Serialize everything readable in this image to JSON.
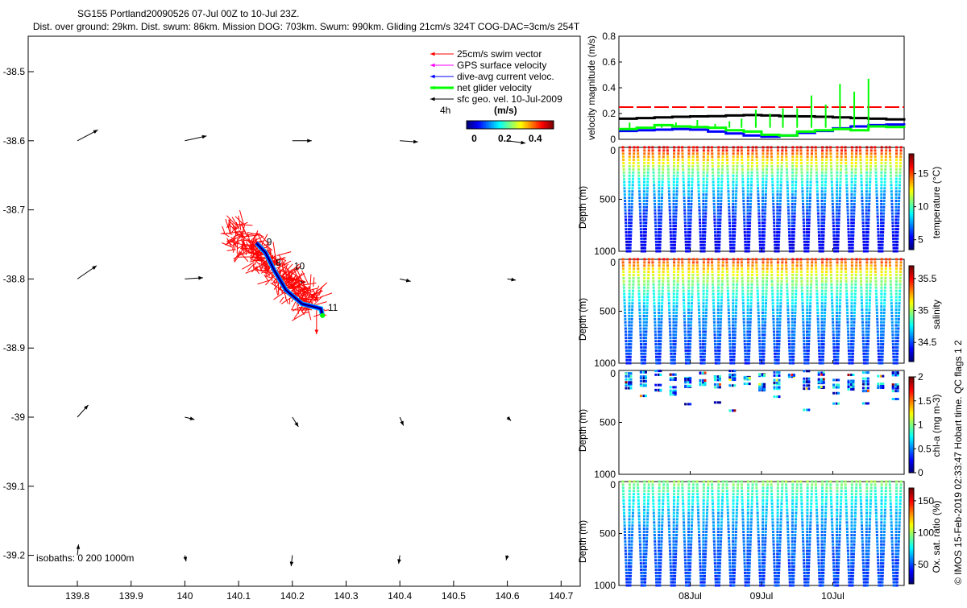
{
  "title": {
    "line1": "SG155 Portland20090526 07-Jul 00Z to 10-Jul 23Z.",
    "line2": "Dist. over ground: 29km. Dist. swum: 86km. Mission DOG: 703km. Swum: 990km. Gliding 21cm/s 324T COG-DAC=3cm/s 254T"
  },
  "footer": "© IMOS 15-Feb-2019 02:33:47 Hobart time. QC flags 1  2",
  "chart_data": [
    {
      "type": "map",
      "xlim": [
        139.72,
        140.73
      ],
      "ylim": [
        -39.28,
        -38.45
      ],
      "xticks": [
        "139.8",
        "139.9",
        "140",
        "140.1",
        "140.2",
        "140.3",
        "140.4",
        "140.5",
        "140.6",
        "140.7"
      ],
      "yticks": [
        "-38.5",
        "-38.6",
        "-38.7",
        "-38.8",
        "-38.9",
        "-39",
        "-39.1",
        "-39.2"
      ],
      "isobath_label": "isobaths: 0   200  1000m",
      "legend": {
        "placement": "top-right",
        "items": [
          {
            "label": "25cm/s swim vector",
            "color": "#ff0000"
          },
          {
            "label": "GPS surface velocity",
            "color": "#ff00ff"
          },
          {
            "label": "dive-avg current veloc.",
            "color": "#0000ff"
          },
          {
            "label": "net glider velocity",
            "color": "#00ff00"
          },
          {
            "label": "sfc geo. vel. 10-Jul-2009",
            "color": "#000000"
          }
        ],
        "time_label": "4h",
        "colorbar_units": "(m/s)",
        "colorbar_ticks": [
          "0",
          "0.2",
          "0.4"
        ],
        "colorbar_range": [
          -0.05,
          0.52
        ]
      },
      "glider_track": [
        [
          140.133,
          -38.748
        ],
        [
          140.15,
          -38.762
        ],
        [
          140.166,
          -38.787
        ],
        [
          140.188,
          -38.816
        ],
        [
          140.218,
          -38.836
        ],
        [
          140.253,
          -38.843
        ],
        [
          140.256,
          -38.853
        ]
      ],
      "track_labels": [
        {
          "text": "8",
          "lon": 140.169,
          "lat": -38.781
        },
        {
          "text": "9",
          "lon": 140.152,
          "lat": -38.751
        },
        {
          "text": "10",
          "lon": 140.203,
          "lat": -38.786
        },
        {
          "text": "11",
          "lon": 140.266,
          "lat": -38.846
        }
      ],
      "sfc_geo_vectors": [
        {
          "lon": 139.8,
          "lat": -38.6,
          "u": 0.17,
          "v": 0.09
        },
        {
          "lon": 140.0,
          "lat": -38.6,
          "u": 0.18,
          "v": 0.04
        },
        {
          "lon": 140.2,
          "lat": -38.6,
          "u": 0.16,
          "v": 0.0
        },
        {
          "lon": 140.4,
          "lat": -38.6,
          "u": 0.15,
          "v": -0.01
        },
        {
          "lon": 140.6,
          "lat": -38.6,
          "u": 0.15,
          "v": -0.02
        },
        {
          "lon": 139.8,
          "lat": -38.8,
          "u": 0.16,
          "v": 0.11
        },
        {
          "lon": 140.0,
          "lat": -38.8,
          "u": 0.15,
          "v": 0.01
        },
        {
          "lon": 140.2,
          "lat": -38.8,
          "u": 0.11,
          "v": -0.03
        },
        {
          "lon": 140.4,
          "lat": -38.8,
          "u": 0.09,
          "v": -0.02
        },
        {
          "lon": 140.6,
          "lat": -38.8,
          "u": 0.07,
          "v": -0.01
        },
        {
          "lon": 139.8,
          "lat": -39.0,
          "u": 0.09,
          "v": 0.1
        },
        {
          "lon": 140.0,
          "lat": -39.0,
          "u": 0.08,
          "v": -0.02
        },
        {
          "lon": 140.2,
          "lat": -39.0,
          "u": 0.05,
          "v": -0.08
        },
        {
          "lon": 140.4,
          "lat": -39.0,
          "u": 0.03,
          "v": -0.07
        },
        {
          "lon": 140.6,
          "lat": -39.0,
          "u": 0.03,
          "v": -0.03
        },
        {
          "lon": 139.8,
          "lat": -39.2,
          "u": 0.01,
          "v": 0.09
        },
        {
          "lon": 140.0,
          "lat": -39.2,
          "u": 0.01,
          "v": -0.05
        },
        {
          "lon": 140.2,
          "lat": -39.2,
          "u": -0.01,
          "v": -0.09
        },
        {
          "lon": 140.4,
          "lat": -39.2,
          "u": -0.01,
          "v": -0.07
        },
        {
          "lon": 140.6,
          "lat": -39.2,
          "u": -0.01,
          "v": -0.04
        }
      ]
    },
    {
      "type": "line",
      "ylabel": "velocity magnitude (m/s)",
      "ylim": [
        0,
        0.8
      ],
      "yticks": [
        "0",
        "0.2",
        "0.4",
        "0.6",
        "0.8"
      ],
      "x_days": [
        7.0,
        7.25,
        7.5,
        7.75,
        8.0,
        8.25,
        8.5,
        8.75,
        9.0,
        9.25,
        9.5,
        9.75,
        10.0,
        10.25,
        10.5,
        10.75,
        11.0
      ],
      "series": [
        {
          "label": "swim",
          "color": "#ff0000",
          "style": "dashed",
          "values": [
            0.25,
            0.25,
            0.25,
            0.25,
            0.25,
            0.25,
            0.25,
            0.25,
            0.25,
            0.25,
            0.25,
            0.25,
            0.25,
            0.25,
            0.25,
            0.25,
            0.25
          ]
        },
        {
          "label": "sfc geo",
          "color": "#000000",
          "values": [
            0.16,
            0.165,
            0.17,
            0.175,
            0.178,
            0.18,
            0.185,
            0.188,
            0.185,
            0.18,
            0.178,
            0.175,
            0.17,
            0.165,
            0.16,
            0.155,
            0.145
          ]
        },
        {
          "label": "dive-avg",
          "color": "#0000ff",
          "values": [
            0.065,
            0.07,
            0.075,
            0.08,
            0.075,
            0.06,
            0.045,
            0.03,
            0.02,
            0.03,
            0.05,
            0.065,
            0.085,
            0.1,
            0.11,
            0.115,
            0.11
          ]
        },
        {
          "label": "net glider",
          "color": "#00ff00",
          "values": [
            0.08,
            0.09,
            0.11,
            0.1,
            0.095,
            0.09,
            0.07,
            0.06,
            0.035,
            0.03,
            0.06,
            0.07,
            0.08,
            0.07,
            0.1,
            0.095,
            0.09
          ]
        }
      ],
      "net_glider_spikes": [
        {
          "day": 7.15,
          "value": 0.13
        },
        {
          "day": 7.6,
          "value": 0.12
        },
        {
          "day": 7.8,
          "value": 0.13
        },
        {
          "day": 8.1,
          "value": 0.15
        },
        {
          "day": 8.35,
          "value": 0.12
        },
        {
          "day": 8.55,
          "value": 0.14
        },
        {
          "day": 8.72,
          "value": 0.16
        },
        {
          "day": 8.92,
          "value": 0.23
        },
        {
          "day": 9.12,
          "value": 0.2
        },
        {
          "day": 9.3,
          "value": 0.24
        },
        {
          "day": 9.5,
          "value": 0.24
        },
        {
          "day": 9.7,
          "value": 0.34
        },
        {
          "day": 9.9,
          "value": 0.27
        },
        {
          "day": 10.1,
          "value": 0.43
        },
        {
          "day": 10.3,
          "value": 0.37
        },
        {
          "day": 10.5,
          "value": 0.47
        }
      ]
    },
    {
      "type": "scatter",
      "variable": "temperature",
      "ylabel": "Depth (m)",
      "yticks": [
        "0",
        "500",
        "1000"
      ],
      "colorbar_label": "temperature (°C)",
      "colorbar_ticks": [
        "5",
        "10",
        "15"
      ],
      "crange": [
        3.5,
        18
      ],
      "surface_value": 16.5,
      "bottom_value": 4.3
    },
    {
      "type": "scatter",
      "variable": "salinity",
      "ylabel": "Depth (m)",
      "yticks": [
        "0",
        "500",
        "1000"
      ],
      "colorbar_label": "salinity",
      "colorbar_ticks": [
        "34.5",
        "35",
        "35.5"
      ],
      "crange": [
        34.2,
        35.7
      ],
      "surface_value": 35.45,
      "bottom_value": 34.4
    },
    {
      "type": "scatter",
      "variable": "chl-a",
      "ylabel": "Depth (m)",
      "yticks": [
        "0",
        "500",
        "1000"
      ],
      "colorbar_label": "chl-a (mg m-3)",
      "colorbar_ticks": [
        "0",
        "0.5",
        "1",
        "1.5",
        "2"
      ],
      "crange": [
        0,
        2
      ],
      "surface_value": 0.6,
      "bottom_value": 0.0
    },
    {
      "type": "scatter",
      "variable": "oxygen",
      "ylabel": "Depth (m)",
      "yticks": [
        "0",
        "500",
        "1000"
      ],
      "colorbar_label": "Ox. sat. ratio (%)",
      "colorbar_ticks": [
        "50",
        "100",
        "150"
      ],
      "crange": [
        20,
        170
      ],
      "surface_value": 98,
      "bottom_value": 45
    },
    {
      "type": "time_axis",
      "xlim_days": [
        7.0,
        11.0
      ],
      "xticks": [
        "08Jul",
        "09Jul",
        "10Jul"
      ],
      "dives": 19
    }
  ]
}
